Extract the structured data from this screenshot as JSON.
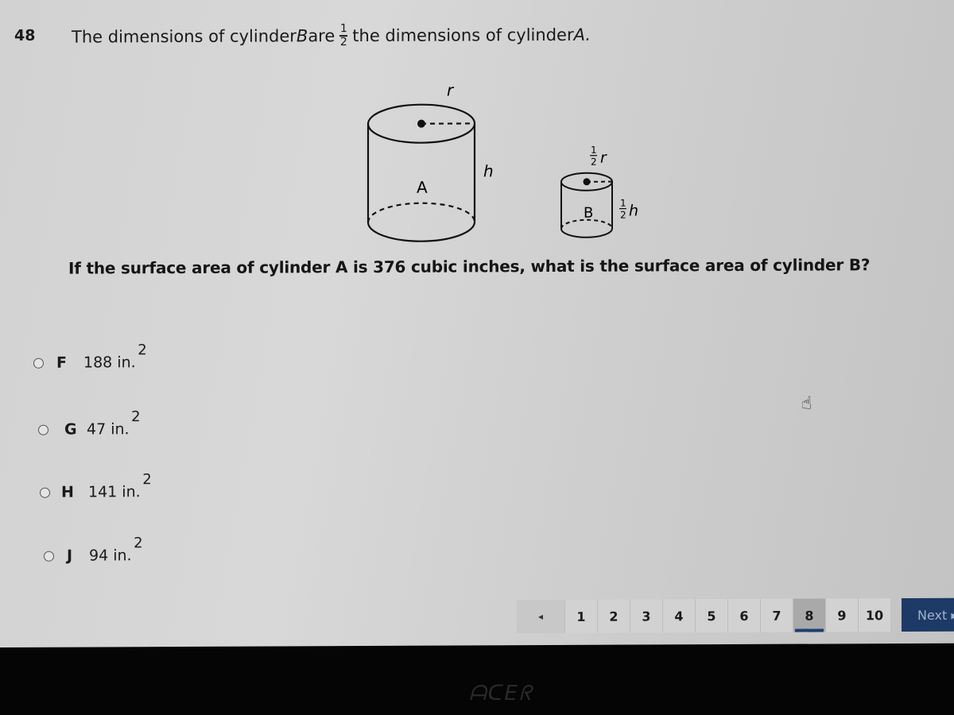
{
  "question": {
    "number": "48",
    "stem_part1": "The dimensions of cylinder ",
    "stem_var_b": "B",
    "stem_part2": " are",
    "fraction_num": "1",
    "fraction_den": "2",
    "stem_part3": "the dimensions of cylinder ",
    "stem_var_a": "A.",
    "prompt": "If the surface area of cylinder A is 376 cubic inches, what is the surface area of cylinder B?"
  },
  "figure": {
    "cyl_a_label": "A",
    "cyl_a_radius": "r",
    "cyl_a_height": "h",
    "cyl_b_label": "B",
    "cyl_b_radius_frac": "1/2",
    "cyl_b_radius_var": "r",
    "cyl_b_height_frac": "1/2",
    "cyl_b_height_var": "h"
  },
  "options": [
    {
      "letter": "F",
      "value": "188 in.",
      "exponent": "2"
    },
    {
      "letter": "G",
      "value": "47 in.",
      "exponent": "2"
    },
    {
      "letter": "H",
      "value": "141 in.",
      "exponent": "2"
    },
    {
      "letter": "J",
      "value": "94 in.",
      "exponent": "2"
    }
  ],
  "pagination": {
    "prev_icon": "◂",
    "pages": [
      "1",
      "2",
      "3",
      "4",
      "5",
      "6",
      "7",
      "8",
      "9",
      "10"
    ],
    "current_page": "8",
    "next_label": "Next ▸"
  },
  "cursor_icon": "☝",
  "bezel_logo": "ᗩᑕEᖇ"
}
